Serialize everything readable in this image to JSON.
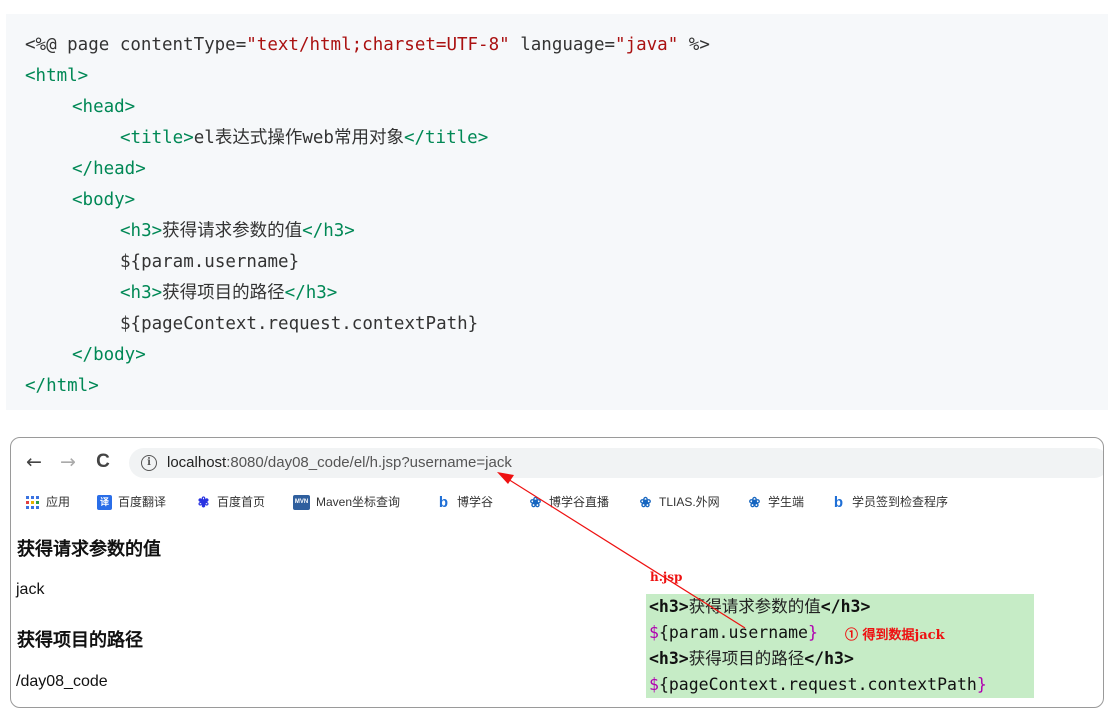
{
  "code": {
    "l1": {
      "a": "<%@ page contentType=",
      "b": "\"text/html;charset=UTF-8\"",
      "c": " language=",
      "d": "\"java\"",
      "e": " %>"
    },
    "l2": "<html>",
    "l3": "<head>",
    "l4": {
      "open": "<title>",
      "text": "el表达式操作web常用对象",
      "close": "</title>"
    },
    "l5": "</head>",
    "l6": "<body>",
    "l7": {
      "open": "<h3>",
      "text": "获得请求参数的值",
      "close": "</h3>"
    },
    "l8": "${param.username}",
    "l9": {
      "open": "<h3>",
      "text": "获得项目的路径",
      "close": "</h3>"
    },
    "l10": "${pageContext.request.contextPath}",
    "l11": "</body>",
    "l12": "</html>"
  },
  "browser": {
    "back": "←",
    "forward": "→",
    "reload": "C",
    "info_icon": "i",
    "url_host": "localhost",
    "url_rest": ":8080/day08_code/el/h.jsp?username=jack",
    "bookmarks": [
      {
        "label": "应用",
        "icon": "apps-grid-icon",
        "color": "#4285f4"
      },
      {
        "label": "百度翻译",
        "icon": "baidu-translate-icon",
        "color": "#2a6ee8"
      },
      {
        "label": "百度首页",
        "icon": "baidu-paw-icon",
        "color": "#2932e1"
      },
      {
        "label": "Maven坐标查询",
        "icon": "maven-icon",
        "color": "#2f5f9e"
      },
      {
        "label": "博学谷",
        "icon": "boxuegu-icon",
        "color": "#1f6fd6"
      },
      {
        "label": "博学谷直播",
        "icon": "live-icon",
        "color": "#1565c0"
      },
      {
        "label": "TLIAS.外网",
        "icon": "tlias-icon",
        "color": "#1565c0"
      },
      {
        "label": "学生端",
        "icon": "student-icon",
        "color": "#1565c0"
      },
      {
        "label": "学员签到检查程序",
        "icon": "checkin-icon",
        "color": "#1f6fd6"
      }
    ],
    "page": {
      "h1": "获得请求参数的值",
      "v1": "jack",
      "h2": "获得项目的路径",
      "v2": "/day08_code"
    }
  },
  "annotation": {
    "file": "h.jsp",
    "line1": {
      "open": "<h3>",
      "text": "获得请求参数的值",
      "close": "</h3>"
    },
    "line2": {
      "el": "${param.username",
      "brace": "}"
    },
    "line3": {
      "open": "<h3>",
      "text": "获得项目的路径",
      "close": "</h3>"
    },
    "line4": {
      "dollar": "$",
      "el": "{pageContext.request.contextPath",
      "brace": "}"
    },
    "note": "① 得到数据jack",
    "arrow_color": "#ee1111"
  }
}
